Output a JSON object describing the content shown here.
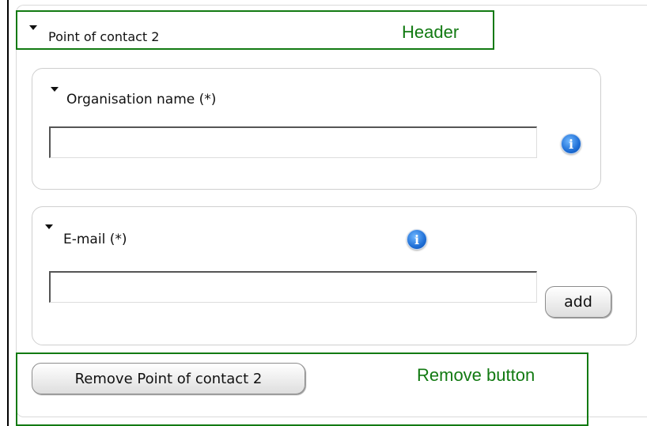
{
  "header": {
    "title": "Point of contact 2"
  },
  "organisation": {
    "label": "Organisation name (*)",
    "value": "",
    "info_icon": "info-icon"
  },
  "email": {
    "label": "E-mail (*)",
    "value": "",
    "add_label": "add",
    "info_icon": "info-icon"
  },
  "remove": {
    "label": "Remove Point of contact 2"
  },
  "annotations": {
    "header": "Header",
    "remove": "Remove button"
  },
  "colors": {
    "annotation": "#127a12",
    "info_icon": "#1f6fd6"
  }
}
